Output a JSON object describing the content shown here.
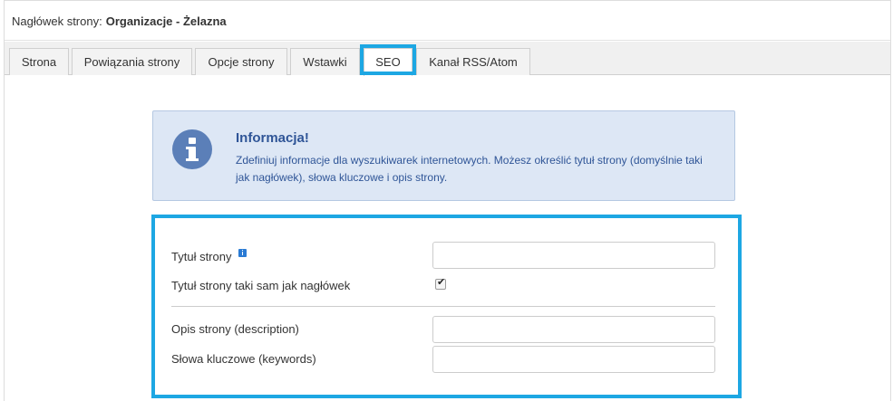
{
  "header": {
    "label_prefix": "Nagłówek strony:",
    "page_name": "Organizacje - Żelazna"
  },
  "tabs": [
    {
      "label": "Strona",
      "active": false
    },
    {
      "label": "Powiązania strony",
      "active": false
    },
    {
      "label": "Opcje strony",
      "active": false
    },
    {
      "label": "Wstawki",
      "active": false
    },
    {
      "label": "SEO",
      "active": true
    },
    {
      "label": "Kanał RSS/Atom",
      "active": false
    }
  ],
  "info": {
    "icon": "info-circle-icon",
    "title": "Informacja!",
    "text": "Zdefiniuj informacje dla wyszukiwarek internetowych. Możesz określić tytuł strony (domyślnie taki jak nagłówek), słowa kluczowe i opis strony."
  },
  "form": {
    "page_title": {
      "label": "Tytuł strony",
      "value": "",
      "hint_icon": "info-square-icon"
    },
    "same_as_header": {
      "label": "Tytuł strony taki sam jak nagłówek",
      "checked": true
    },
    "description": {
      "label": "Opis strony (description)",
      "value": ""
    },
    "keywords": {
      "label": "Słowa kluczowe (keywords)",
      "value": ""
    }
  },
  "colors": {
    "highlight": "#1da7e3",
    "info_background": "#dde7f5",
    "info_text": "#2f5597",
    "info_icon": "#5b7fb8"
  }
}
